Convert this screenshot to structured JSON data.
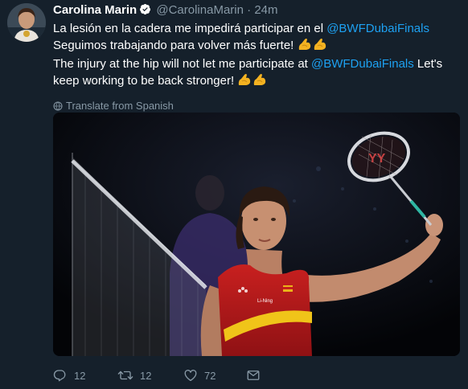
{
  "tweet": {
    "author_name": "Carolina Marin",
    "handle": "@CarolinaMarin",
    "separator": "·",
    "time": "24m",
    "text_es_pre": "La lesión en la cadera me impedirá participar en el ",
    "mention_1": "@BWFDubaiFinals",
    "text_es_post": " Seguimos trabajando para volver más fuerte! ",
    "text_en_pre": "The injury at the hip will not let me participate at ",
    "mention_2": "@BWFDubaiFinals",
    "text_en_post": " Let's keep working to be back stronger! ",
    "translate_label": "Translate from Spanish",
    "icons": {
      "verified": "verified-badge-icon",
      "emoji": "flexed-biceps-emoji",
      "globe": "globe-icon",
      "reply": "reply-icon",
      "retweet": "retweet-icon",
      "like": "heart-icon",
      "dm": "envelope-icon"
    },
    "actions": {
      "replies": "12",
      "retweets": "12",
      "likes": "72"
    }
  },
  "colors": {
    "background": "#15202b",
    "link": "#1da1f2",
    "muted": "#8899a6",
    "retweet_active": "#17bf63"
  }
}
